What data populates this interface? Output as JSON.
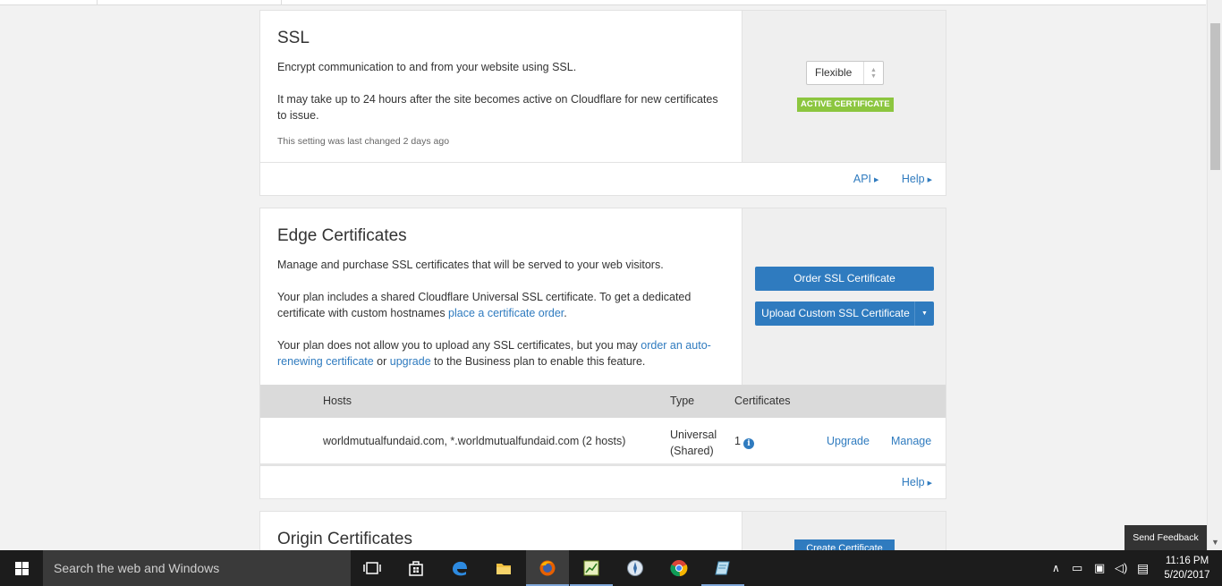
{
  "ssl": {
    "title": "SSL",
    "desc1": "Encrypt communication to and from your website using SSL.",
    "desc2": "It may take up to 24 hours after the site becomes active on Cloudflare for new certificates to issue.",
    "last_changed": "This setting was last changed 2 days ago",
    "mode_value": "Flexible",
    "badge": "ACTIVE CERTIFICATE",
    "api_link": "API",
    "help_link": "Help"
  },
  "edge": {
    "title": "Edge Certificates",
    "desc1": "Manage and purchase SSL certificates that will be served to your web visitors.",
    "desc2_pre": "Your plan includes a shared Cloudflare Universal SSL certificate. To get a dedicated certificate with custom hostnames ",
    "desc2_link": "place a certificate order",
    "desc2_post": ".",
    "desc3_pre": "Your plan does not allow you to upload any SSL certificates, but you may ",
    "desc3_link1": "order an auto-renewing certificate",
    "desc3_mid": " or ",
    "desc3_link2": "upgrade",
    "desc3_post": " to the Business plan to enable this feature.",
    "order_button": "Order SSL Certificate",
    "upload_button": "Upload Custom SSL Certificate",
    "table": {
      "headers": {
        "hosts": "Hosts",
        "type": "Type",
        "certificates": "Certificates"
      },
      "rows": [
        {
          "hosts": "worldmutualfundaid.com, *.worldmutualfundaid.com (2 hosts)",
          "type_line1": "Universal",
          "type_line2": "(Shared)",
          "certificates": "1",
          "upgrade": "Upgrade",
          "manage": "Manage"
        }
      ]
    },
    "help_link": "Help"
  },
  "origin": {
    "title": "Origin Certificates",
    "create_button": "Create Certificate"
  },
  "feedback": "Send Feedback",
  "taskbar": {
    "search_placeholder": "Search the web and Windows",
    "time": "11:16 PM",
    "date": "5/20/2017"
  },
  "colors": {
    "accent": "#2f7bbf",
    "badge_green": "#8cc63f",
    "taskbar": "#1c1c1c"
  }
}
